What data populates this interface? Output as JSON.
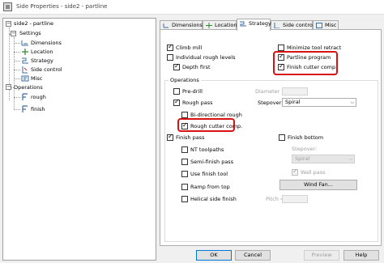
{
  "window": {
    "title": "Side Properties - side2 - partline"
  },
  "tree": {
    "root": "side2 - partline",
    "settings_label": "Settings",
    "settings_items": [
      "Dimensions",
      "Location",
      "Strategy",
      "Side control",
      "Misc"
    ],
    "operations_label": "Operations",
    "operations_items": [
      "rough",
      "finish"
    ]
  },
  "tabs": [
    {
      "label": "Dimensions",
      "active": false
    },
    {
      "label": "Location",
      "active": false
    },
    {
      "label": "Strategy",
      "active": true
    },
    {
      "label": "Side control",
      "active": false
    },
    {
      "label": "Misc",
      "active": false
    }
  ],
  "strategy": {
    "climb_mill": "Climb mill",
    "individual_rough_levels": "Individual rough levels",
    "depth_first": "Depth first",
    "minimize_tool_retract": "Minimize tool retract",
    "partline_program": "Partline program",
    "finish_cutter_comp": "Finish cutter comp.",
    "operations_group": "Operations",
    "pre_drill": "Pre-drill",
    "diameter_label": "Diameter =",
    "rough_pass": "Rough pass",
    "stepover_label": "Stepover:",
    "stepover_value": "Spiral",
    "bi_directional_rough": "Bi-directional rough",
    "rough_cutter_comp": "Rough cutter comp.",
    "finish_pass": "Finish pass",
    "finish_bottom": "Finish bottom",
    "nt_toolpaths": "NT toolpaths",
    "stepover_label_2": "Stepover:",
    "semi_finish_pass": "Semi-finish pass",
    "stepover_value_2": "Spiral",
    "use_finish_tool": "Use finish tool",
    "wall_pass": "Wall pass",
    "ramp_from_top": "Ramp from top",
    "wind_fan_button": "Wind Fan...",
    "helical_side_finish": "Helical side finish",
    "pitch_label": "Pitch ="
  },
  "footer": {
    "ok": "OK",
    "cancel": "Cancel",
    "preview": "Preview",
    "help": "Help"
  },
  "annotation_color": "#d81212"
}
